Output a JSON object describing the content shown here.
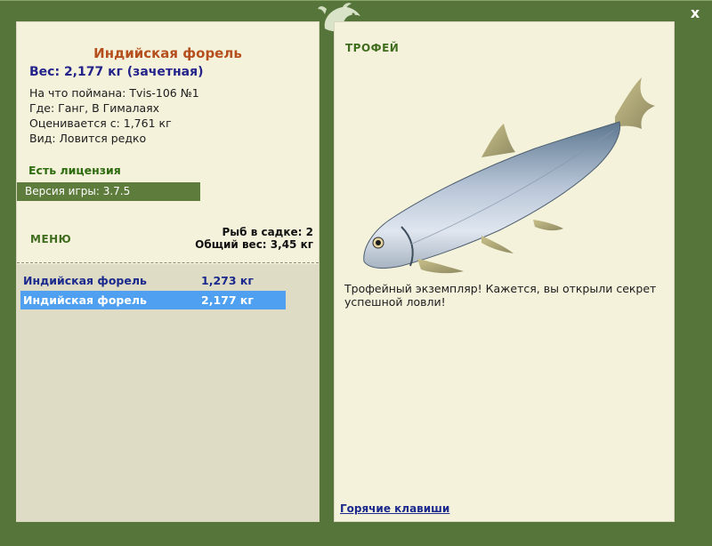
{
  "window": {
    "close_label": "x"
  },
  "fish": {
    "title": "Индийская форель",
    "weight_line": "Вес: 2,177 кг (зачетная)",
    "info": [
      "На что поймана: Tvis-106 №1",
      "Где: Ганг, В Гималаях",
      "Оценивается с: 1,761 кг",
      "Вид: Ловится редко"
    ]
  },
  "license": "Есть лицензия",
  "version": "Версия игры: 3.7.5",
  "menu_label": "Меню",
  "cage": {
    "count_line": "Рыб в садке: 2",
    "total_line": "Общий вес: 3,45 кг"
  },
  "catch_list": [
    {
      "name": "Индийская форель",
      "weight": "1,273 кг",
      "selected": false
    },
    {
      "name": "Индийская форель",
      "weight": "2,177 кг",
      "selected": true
    }
  ],
  "trophy": {
    "label": "Трофей",
    "description": "Трофейный экземпляр! Кажется, вы открыли секрет успешной ловли!"
  },
  "hotkeys_link": "Горячие клавиши",
  "colors": {
    "frame": "#56753a",
    "panel": "#f5f2dc",
    "list_bg": "#dedcc5",
    "selected_row": "#4fa0f0",
    "title": "#b5501e",
    "accent_green": "#3f6d1d",
    "link_blue": "#1b2a8c"
  },
  "icons": {
    "close": "close-icon",
    "logo": "fish-logo-icon"
  }
}
